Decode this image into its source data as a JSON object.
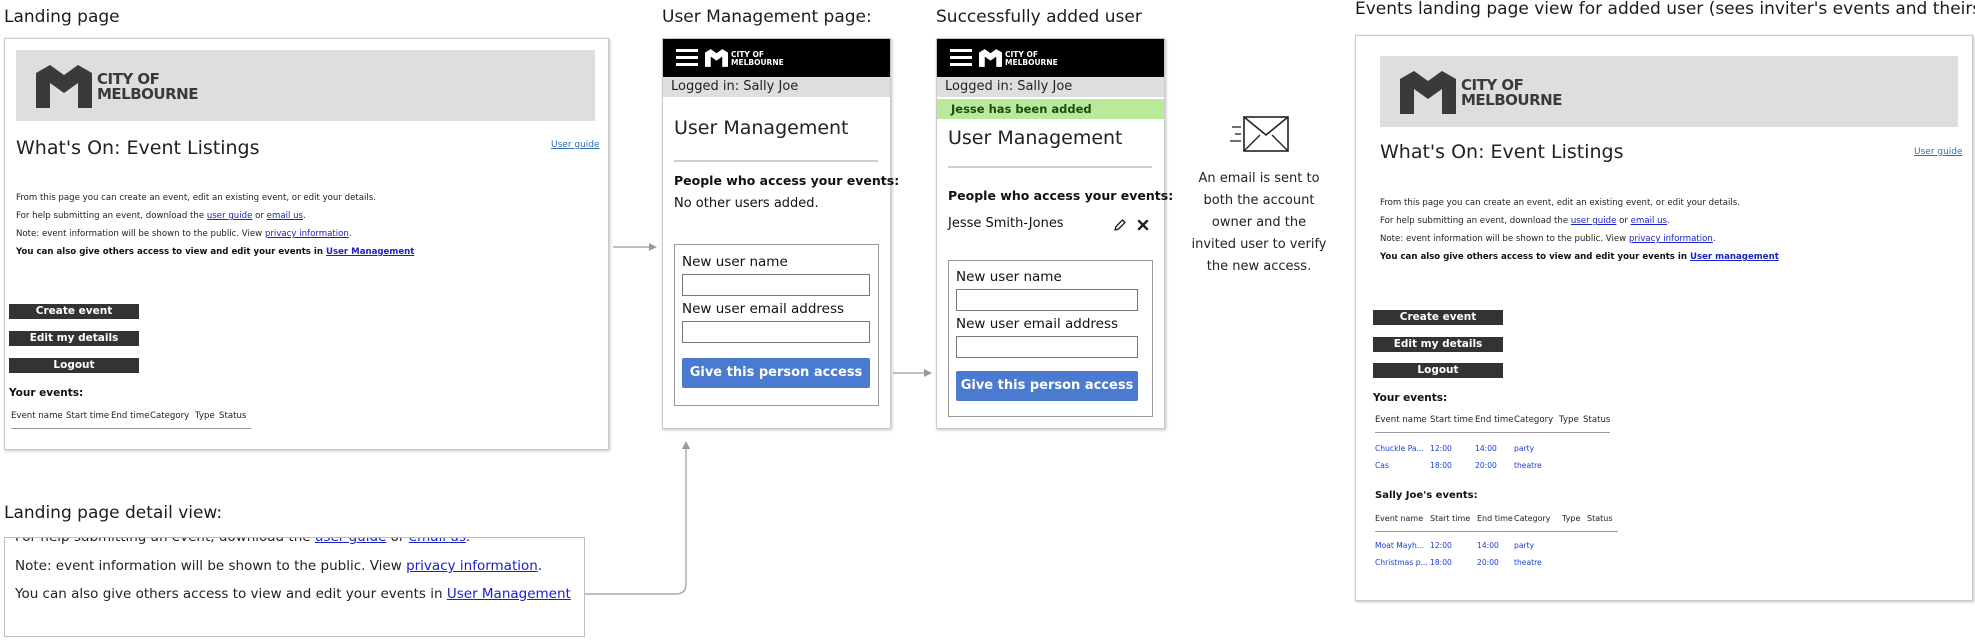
{
  "captions": {
    "landing": "Landing page",
    "user_mgmt": "User Management page:",
    "added": "Successfully added user",
    "events_view": "Events landing page view for added user (sees inviter's events and theirs)",
    "detail": "Landing page detail view:"
  },
  "logo": {
    "line1": "CITY OF",
    "line2": "MELBOURNE"
  },
  "landing": {
    "title": "What's On: Event Listings",
    "user_guide": "User guide",
    "intro": "From this page you can create an event, edit an existing event, or edit your details.",
    "help_pre": "For help submitting an event, download the",
    "help_link1": "user guide",
    "help_mid": "or",
    "help_link2": "email us",
    "help_post": ".",
    "note_pre": "Note: event information will be shown to the public. View",
    "note_link": "privacy information",
    "note_post": ".",
    "access_pre": "You can also give others access to view and edit your events in",
    "access_link": "User Management",
    "buttons": [
      "Create event",
      "Edit my details",
      "Logout"
    ],
    "your_events": "Your events:",
    "columns": [
      "Event name",
      "Start time",
      "End time",
      "Category",
      "Type",
      "Status"
    ]
  },
  "mobile": {
    "logged_in": "Logged in: Sally Joe",
    "heading": "User Management",
    "people_label": "People who access your events:",
    "no_users": "No other users added.",
    "new_name_label": "New user name",
    "new_email_label": "New user email address",
    "give_button": "Give this person access",
    "success_msg": "Jesse has been added",
    "added_user": "Jesse Smith-Jones"
  },
  "email_note": [
    "An email is sent to",
    "both the account",
    "owner and the",
    "invited user to verify",
    "the new access."
  ],
  "detail": {
    "line1_pre": "For help submitting an event, download the",
    "line1_link1": "user guide",
    "line1_mid": "or",
    "line1_link2": "email us",
    "line1_post": ".",
    "line2_pre": "Note: event information will be shown to the public. View",
    "line2_link": "privacy information",
    "line2_post": ".",
    "line3_pre": "You can also give others access to view and edit your events in",
    "line3_link": "User Management"
  },
  "events_page": {
    "title": "What's On: Event Listings",
    "user_guide": "User guide",
    "access_link": "User management",
    "your_events": "Your events:",
    "your_rows": [
      [
        "Chuckle Pa...",
        "12:00",
        "14:00",
        "party"
      ],
      [
        "Cas",
        "18:00",
        "20:00",
        "theatre"
      ]
    ],
    "sally_events": "Sally Joe's events:",
    "sally_rows": [
      [
        "Moat Mayh...",
        "12:00",
        "14:00",
        "party"
      ],
      [
        "Christmas p...",
        "18:00",
        "20:00",
        "theatre"
      ]
    ]
  }
}
